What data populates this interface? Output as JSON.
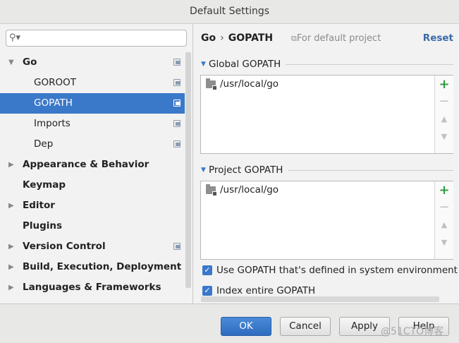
{
  "window": {
    "title": "Default Settings"
  },
  "sidebar": {
    "items": [
      {
        "label": "Go",
        "bold": true,
        "arrow": "▼",
        "copy": true,
        "indent": 32
      },
      {
        "label": "GOROOT",
        "bold": false,
        "arrow": "",
        "copy": true,
        "indent": 48
      },
      {
        "label": "GOPATH",
        "bold": false,
        "arrow": "",
        "copy": true,
        "indent": 48,
        "selected": true
      },
      {
        "label": "Imports",
        "bold": false,
        "arrow": "",
        "copy": true,
        "indent": 48
      },
      {
        "label": "Dep",
        "bold": false,
        "arrow": "",
        "copy": true,
        "indent": 48
      },
      {
        "label": "Appearance & Behavior",
        "bold": true,
        "arrow": "▶",
        "copy": false,
        "indent": 32
      },
      {
        "label": "Keymap",
        "bold": true,
        "arrow": "",
        "copy": false,
        "indent": 32
      },
      {
        "label": "Editor",
        "bold": true,
        "arrow": "▶",
        "copy": false,
        "indent": 32
      },
      {
        "label": "Plugins",
        "bold": true,
        "arrow": "",
        "copy": false,
        "indent": 32
      },
      {
        "label": "Version Control",
        "bold": true,
        "arrow": "▶",
        "copy": true,
        "indent": 32
      },
      {
        "label": "Build, Execution, Deployment",
        "bold": true,
        "arrow": "▶",
        "copy": false,
        "indent": 32
      },
      {
        "label": "Languages & Frameworks",
        "bold": true,
        "arrow": "▶",
        "copy": false,
        "indent": 32
      }
    ]
  },
  "breadcrumb": {
    "parent": "Go",
    "separator": "›",
    "current": "GOPATH"
  },
  "scope_label": "For default project",
  "reset_label": "Reset",
  "global_gopath": {
    "header": "Global GOPATH",
    "entries": [
      "/usr/local/go"
    ]
  },
  "project_gopath": {
    "header": "Project GOPATH",
    "entries": [
      "/usr/local/go"
    ]
  },
  "checkboxes": {
    "use_system": {
      "label": "Use GOPATH that's defined in system environment",
      "checked": true
    },
    "index_entire": {
      "label": "Index entire GOPATH",
      "checked": true
    }
  },
  "buttons": {
    "ok": "OK",
    "cancel": "Cancel",
    "apply": "Apply",
    "help": "Help"
  },
  "watermark": "@51CTO博客",
  "colors": {
    "selection": "#3a78c9",
    "add": "#2e9c3c",
    "link": "#3a6aa8"
  }
}
